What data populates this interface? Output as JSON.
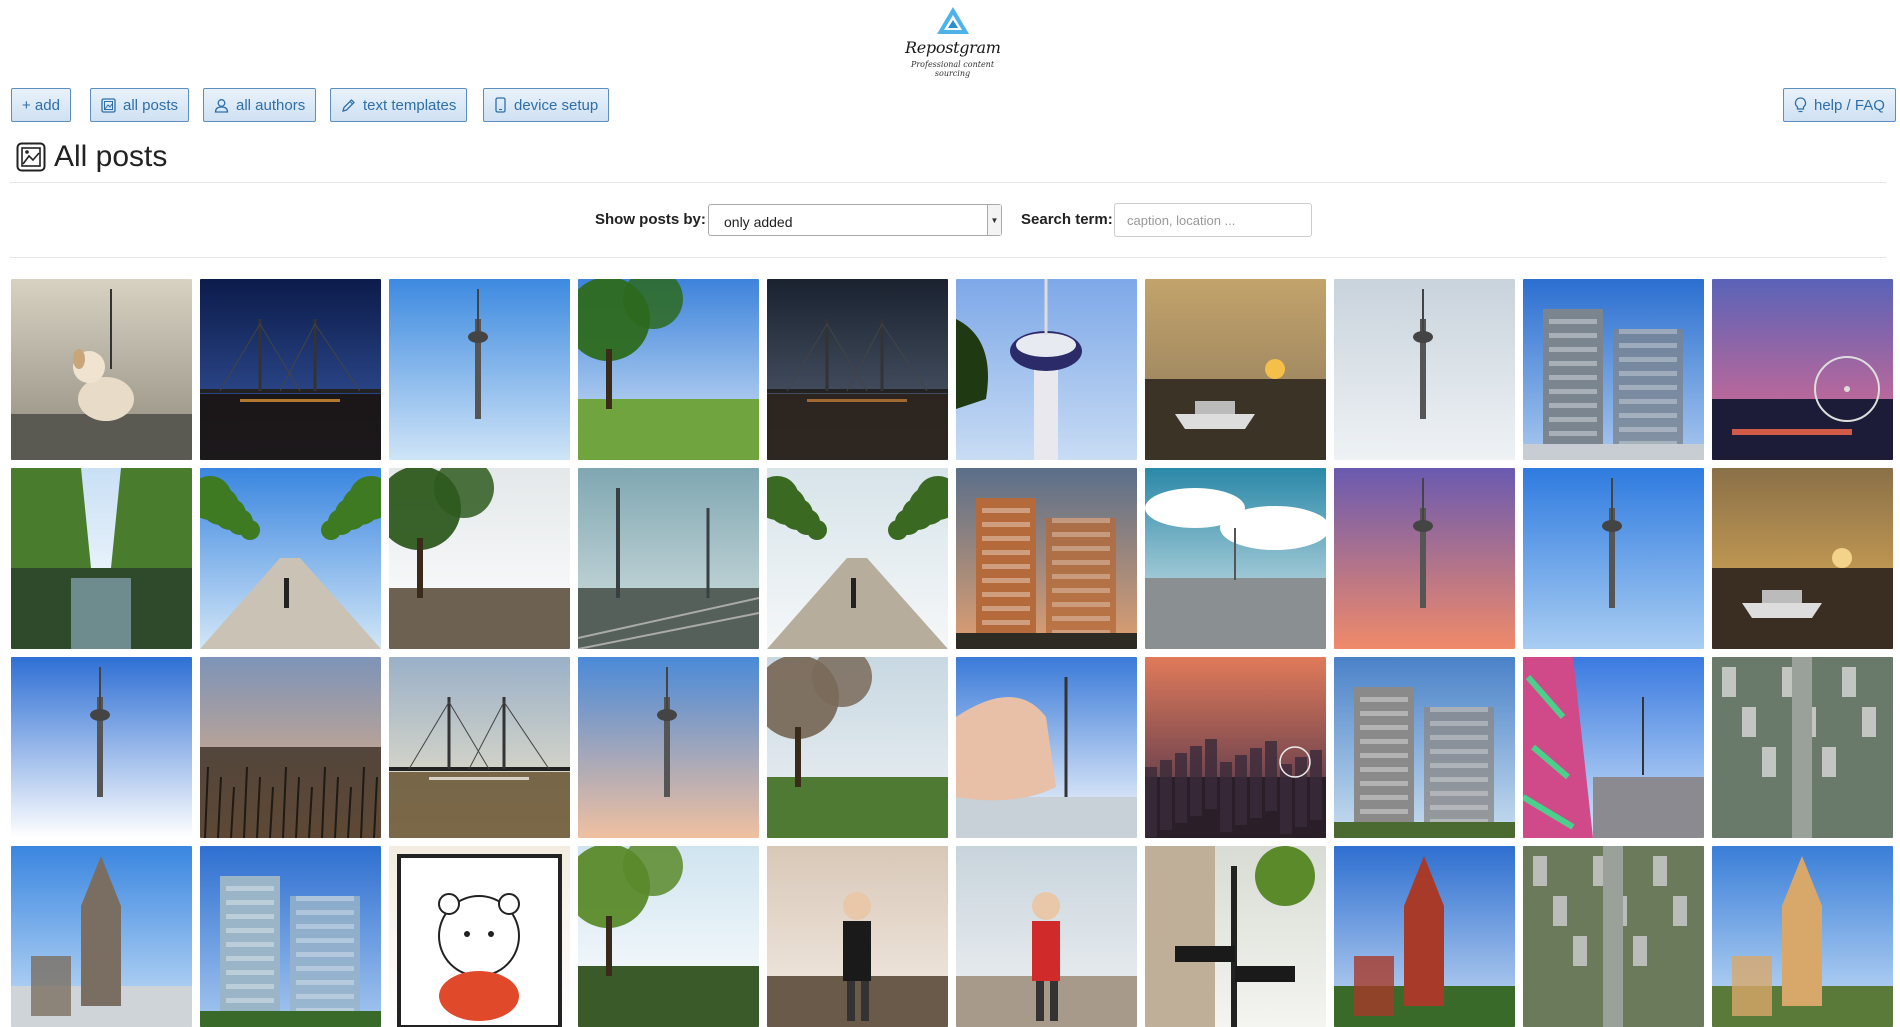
{
  "brand": {
    "name": "Repostgram",
    "tagline": "Professional content sourcing"
  },
  "toolbar": {
    "add": "+ add",
    "all_posts": "all posts",
    "all_authors": "all authors",
    "text_templates": "text templates",
    "device_setup": "device setup",
    "help": "help / FAQ"
  },
  "page": {
    "title": "All posts"
  },
  "filters": {
    "show_label": "Show posts by:",
    "show_selected": "only added",
    "search_label": "Search term:",
    "search_placeholder": "caption, location ..."
  },
  "posts": [
    {
      "subject": "dog on promenade",
      "sky": [
        "#d7d2c2",
        "#8f8a7d"
      ],
      "ground": "#4a4a44",
      "accent": "#c9a67a",
      "motif": "dog"
    },
    {
      "subject": "bridge at night",
      "sky": [
        "#0c1b4a",
        "#3a5ca8"
      ],
      "ground": "#1a120c",
      "accent": "#f3a33a",
      "motif": "bridge"
    },
    {
      "subject": "tower over meadow",
      "sky": [
        "#3d8ae0",
        "#cfe4f7"
      ],
      "ground": "#8a9a3c",
      "accent": "#2f5a2a",
      "motif": "tower"
    },
    {
      "subject": "tree branches river",
      "sky": [
        "#3d83db",
        "#dbe9f7"
      ],
      "ground": "#6fa43f",
      "accent": "#2d6a1e",
      "motif": "tree"
    },
    {
      "subject": "bridge dusk",
      "sky": [
        "#1a2230",
        "#596476"
      ],
      "ground": "#2a2018",
      "accent": "#d2873a",
      "motif": "bridge"
    },
    {
      "subject": "tower top",
      "sky": [
        "#7da8e8",
        "#c8dcf4"
      ],
      "ground": "#2b3b6a",
      "accent": "#ffffff",
      "motif": "towertop"
    },
    {
      "subject": "boat sunset",
      "sky": [
        "#c2a36b",
        "#8b775b"
      ],
      "ground": "#3c3327",
      "accent": "#f4c04a",
      "motif": "boat"
    },
    {
      "subject": "aerial tower view",
      "sky": [
        "#c9d3dc",
        "#eef2f5"
      ],
      "ground": "#6b7a60",
      "accent": "#9a9a9a",
      "motif": "tower"
    },
    {
      "subject": "gehry building",
      "sky": [
        "#2b6fd0",
        "#a9c8ef"
      ],
      "ground": "#c8cdd3",
      "accent": "#7b8590",
      "motif": "building"
    },
    {
      "subject": "ferris wheel sunset",
      "sky": [
        "#5a63b8",
        "#e86a8c"
      ],
      "ground": "#1c1c38",
      "accent": "#ff6b4a",
      "motif": "wheel"
    },
    {
      "subject": "canal trees",
      "sky": [
        "#c9e0f5",
        "#ffffff"
      ],
      "ground": "#2e4a2a",
      "accent": "#4a7c2e",
      "motif": "canal"
    },
    {
      "subject": "promenade trees",
      "sky": [
        "#3a86e0",
        "#d2e6f7"
      ],
      "ground": "#c9c2b5",
      "accent": "#3d7a22",
      "motif": "avenue"
    },
    {
      "subject": "flood reflection",
      "sky": [
        "#e4e8ea",
        "#ffffff"
      ],
      "ground": "#6d6252",
      "accent": "#2e5a1e",
      "motif": "tree"
    },
    {
      "subject": "railway pylons",
      "sky": [
        "#7fa7b2",
        "#d9e4e3"
      ],
      "ground": "#55605a",
      "accent": "#394044",
      "motif": "rail"
    },
    {
      "subject": "walkers on path",
      "sky": [
        "#d7e4ea",
        "#f5f7f8"
      ],
      "ground": "#b7ad9c",
      "accent": "#3a6a22",
      "motif": "avenue"
    },
    {
      "subject": "media harbour towers",
      "sky": [
        "#5a6f8a",
        "#e0a070"
      ],
      "ground": "#2e2a24",
      "accent": "#b46a3a",
      "motif": "building"
    },
    {
      "subject": "clouds over rhine",
      "sky": [
        "#2a88a8",
        "#e8f0f2"
      ],
      "ground": "#8a8f92",
      "accent": "#ffffff",
      "motif": "clouds"
    },
    {
      "subject": "tower purple sky",
      "sky": [
        "#6a5ab0",
        "#f08a6a"
      ],
      "ground": "#241c2e",
      "accent": "#111111",
      "motif": "tower"
    },
    {
      "subject": "tower with trees",
      "sky": [
        "#2f7be0",
        "#a9cdf2"
      ],
      "ground": "#3d7a2a",
      "accent": "#ffffff",
      "motif": "tower"
    },
    {
      "subject": "harbour golden clouds",
      "sky": [
        "#8a7048",
        "#e8b45a"
      ],
      "ground": "#3a2e22",
      "accent": "#f3d28a",
      "motif": "boat"
    },
    {
      "subject": "tower clouds harbour",
      "sky": [
        "#2e6fd4",
        "#ffffff"
      ],
      "ground": "#4d6a7a",
      "accent": "#e8e8e8",
      "motif": "tower"
    },
    {
      "subject": "sunset lake reeds",
      "sky": [
        "#7d94b8",
        "#f0b07a"
      ],
      "ground": "#3a2e24",
      "accent": "#1e1a14",
      "motif": "reeds"
    },
    {
      "subject": "sun under bridge",
      "sky": [
        "#9ab0c8",
        "#f4e8c8"
      ],
      "ground": "#6d5a3a",
      "accent": "#ffffff",
      "motif": "bridge"
    },
    {
      "subject": "tower pink cloud",
      "sky": [
        "#4a8ad8",
        "#f0c0a0"
      ],
      "ground": "#3a3a2a",
      "accent": "#e88a6a",
      "motif": "tower"
    },
    {
      "subject": "park with bridge",
      "sky": [
        "#c8d8e2",
        "#eef2f4"
      ],
      "ground": "#4e7a34",
      "accent": "#7a6a5a",
      "motif": "tree"
    },
    {
      "subject": "hand holding tower",
      "sky": [
        "#3a7ad8",
        "#ffffff"
      ],
      "ground": "#c8d0d8",
      "accent": "#e8c0a8",
      "motif": "hand"
    },
    {
      "subject": "skyline sunset",
      "sky": [
        "#e07a5a",
        "#3a2a48"
      ],
      "ground": "#2a1e28",
      "accent": "#f0a070",
      "motif": "skyline"
    },
    {
      "subject": "fountain park",
      "sky": [
        "#4a82c8",
        "#c9def0"
      ],
      "ground": "#4a6a32",
      "accent": "#8a8a8a",
      "motif": "building"
    },
    {
      "subject": "graffiti walkway",
      "sky": [
        "#3a7ae0",
        "#d0e4f8"
      ],
      "ground": "#8a8a90",
      "accent": "#d04a8a",
      "motif": "graffiti"
    },
    {
      "subject": "aerial harbour",
      "sky": [
        "#a8b0a8",
        "#e0e4e0"
      ],
      "ground": "#6a7a6a",
      "accent": "#d8d8d8",
      "motif": "aerial"
    },
    {
      "subject": "old town tower",
      "sky": [
        "#3a86e0",
        "#c8e0f7"
      ],
      "ground": "#cfd4d8",
      "accent": "#7a6e62",
      "motif": "church"
    },
    {
      "subject": "glass office",
      "sky": [
        "#2e6fd0",
        "#a6c8f0"
      ],
      "ground": "#3a6a2a",
      "accent": "#9ab4c8",
      "motif": "building"
    },
    {
      "subject": "cartoon bear",
      "sky": [
        "#f4ece0",
        "#ffffff"
      ],
      "ground": "#f4ece0",
      "accent": "#e04a2a",
      "motif": "bear"
    },
    {
      "subject": "park pond",
      "sky": [
        "#d0e4f0",
        "#ffffff"
      ],
      "ground": "#3a5a2a",
      "accent": "#5a8a2a",
      "motif": "tree"
    },
    {
      "subject": "woman on bench",
      "sky": [
        "#d8c8b8",
        "#f4ece4"
      ],
      "ground": "#6a5a4a",
      "accent": "#1a1a1a",
      "motif": "person"
    },
    {
      "subject": "woman red dress",
      "sky": [
        "#c8d4dc",
        "#f0f2f4"
      ],
      "ground": "#a89a8a",
      "accent": "#d02a2a",
      "motif": "person"
    },
    {
      "subject": "altstadt street sign",
      "sky": [
        "#d8dcd4",
        "#f4f4f0"
      ],
      "ground": "#8a7a6a",
      "accent": "#1a1a1a",
      "motif": "sign"
    },
    {
      "subject": "red church",
      "sky": [
        "#2e6fd0",
        "#c8dcf4"
      ],
      "ground": "#3a6a2a",
      "accent": "#a83a2a",
      "motif": "church"
    },
    {
      "subject": "aerial avenue",
      "sky": [
        "#8a8a88",
        "#d4d4d0"
      ],
      "ground": "#6a7a5a",
      "accent": "#cfcfcf",
      "motif": "aerial"
    },
    {
      "subject": "market umbrella",
      "sky": [
        "#3a7ed8",
        "#c8e0f7"
      ],
      "ground": "#5a7a3a",
      "accent": "#d8a86a",
      "motif": "church"
    }
  ]
}
